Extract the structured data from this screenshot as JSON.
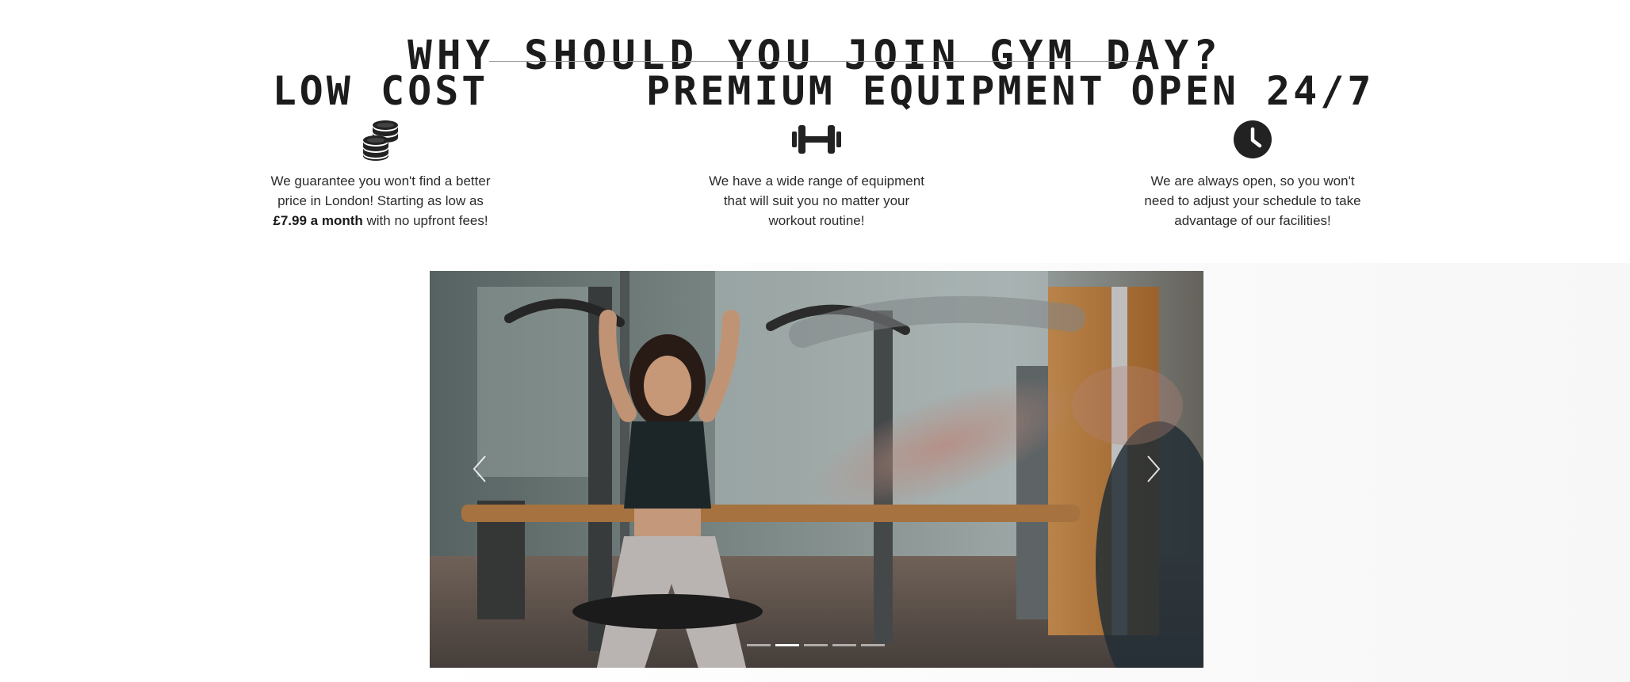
{
  "section": {
    "title": "WHY SHOULD YOU JOIN GYM DAY?"
  },
  "features": [
    {
      "title": "LOW COST",
      "icon": "coins-icon",
      "text_before": "We guarantee you won't find a better price in London! Starting as low as ",
      "text_bold": "£7.99 a month",
      "text_after": " with no upfront fees!"
    },
    {
      "title": "PREMIUM EQUIPMENT",
      "icon": "dumbbell-icon",
      "text": "We have a wide range of equipment that will suit you no matter your workout routine!"
    },
    {
      "title": "OPEN 24/7",
      "icon": "clock-icon",
      "text": "We are always open, so you won't need to adjust your schedule to take advantage of our facilities!"
    }
  ],
  "carousel": {
    "slide_count": 5,
    "active_index": 1,
    "prev_icon": "chevron-left-icon",
    "next_icon": "chevron-right-icon"
  },
  "colors": {
    "text": "#1c1c1c",
    "divider": "#9b9b9b",
    "icon": "#222222"
  }
}
